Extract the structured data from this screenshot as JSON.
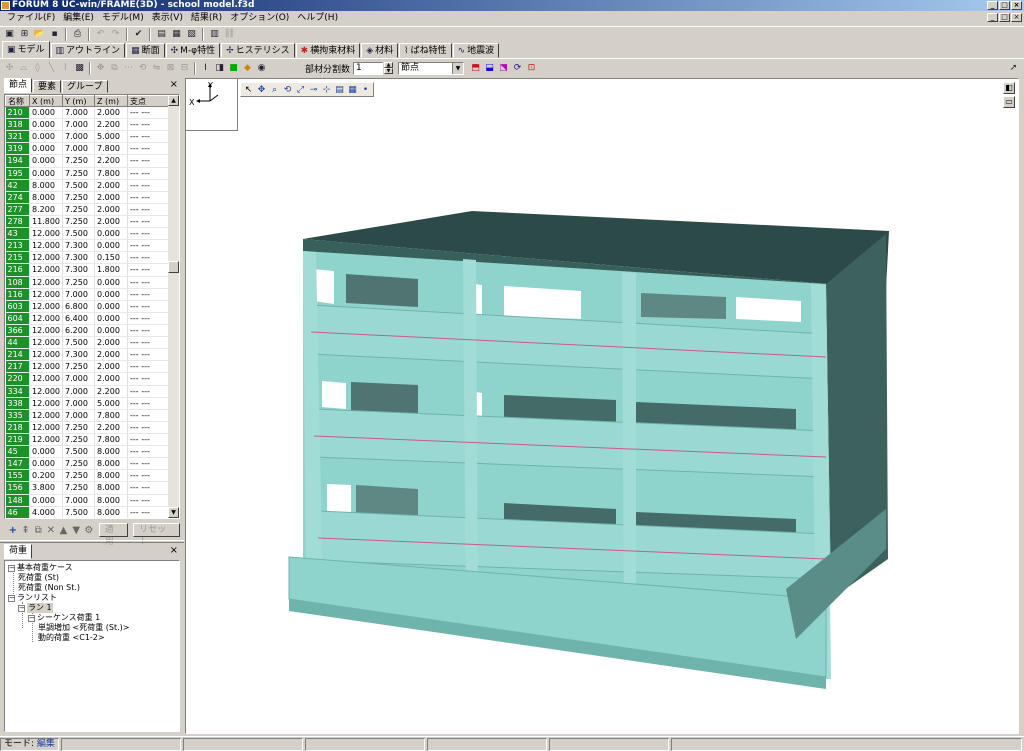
{
  "window": {
    "title": "FORUM 8  UC-win/FRAME(3D) - school model.f3d",
    "buttons": [
      "_",
      "□",
      "×"
    ]
  },
  "menu": [
    "ファイル(F)",
    "編集(E)",
    "モデル(M)",
    "表示(V)",
    "結果(R)",
    "オプション(O)",
    "ヘルプ(H)"
  ],
  "tabs": [
    {
      "label": "モデル",
      "icon": "model-icon",
      "active": true
    },
    {
      "label": "アウトライン",
      "icon": "outline-icon"
    },
    {
      "label": "断面",
      "icon": "section-icon"
    },
    {
      "label": "M-φ特性",
      "icon": "m-phi-icon"
    },
    {
      "label": "ヒステリシス",
      "icon": "hysteresis-icon"
    },
    {
      "label": "横拘束材料",
      "icon": "confinement-icon"
    },
    {
      "label": "材料",
      "icon": "material-icon"
    },
    {
      "label": "ばね特性",
      "icon": "spring-icon"
    },
    {
      "label": "地震波",
      "icon": "wave-icon"
    }
  ],
  "toolbar2": {
    "segment_label": "部材分割数",
    "segment_value": "1",
    "select_value": "節点"
  },
  "left_panel": {
    "tabs": [
      "節点",
      "要素",
      "グループ"
    ],
    "close": "×",
    "columns": [
      "名称",
      "X (m)",
      "Y (m)",
      "Z (m)",
      "支点"
    ],
    "rows": [
      [
        "210",
        "0.000",
        "7.000",
        "2.000",
        "--- ---"
      ],
      [
        "318",
        "0.000",
        "7.000",
        "2.200",
        "--- ---"
      ],
      [
        "321",
        "0.000",
        "7.000",
        "5.000",
        "--- ---"
      ],
      [
        "319",
        "0.000",
        "7.000",
        "7.800",
        "--- ---"
      ],
      [
        "194",
        "0.000",
        "7.250",
        "2.200",
        "--- ---"
      ],
      [
        "195",
        "0.000",
        "7.250",
        "7.800",
        "--- ---"
      ],
      [
        "42",
        "8.000",
        "7.500",
        "2.000",
        "--- ---"
      ],
      [
        "274",
        "8.000",
        "7.250",
        "2.000",
        "--- ---"
      ],
      [
        "277",
        "8.200",
        "7.250",
        "2.000",
        "--- ---"
      ],
      [
        "278",
        "11.800",
        "7.250",
        "2.000",
        "--- ---"
      ],
      [
        "43",
        "12.000",
        "7.500",
        "0.000",
        "--- ---"
      ],
      [
        "213",
        "12.000",
        "7.300",
        "0.000",
        "--- ---"
      ],
      [
        "215",
        "12.000",
        "7.300",
        "0.150",
        "--- ---"
      ],
      [
        "216",
        "12.000",
        "7.300",
        "1.800",
        "--- ---"
      ],
      [
        "108",
        "12.000",
        "7.250",
        "0.000",
        "--- ---"
      ],
      [
        "116",
        "12.000",
        "7.000",
        "0.000",
        "--- ---"
      ],
      [
        "603",
        "12.000",
        "6.800",
        "0.000",
        "--- ---"
      ],
      [
        "604",
        "12.000",
        "6.400",
        "0.000",
        "--- ---"
      ],
      [
        "366",
        "12.000",
        "6.200",
        "0.000",
        "--- ---"
      ],
      [
        "44",
        "12.000",
        "7.500",
        "2.000",
        "--- ---"
      ],
      [
        "214",
        "12.000",
        "7.300",
        "2.000",
        "--- ---"
      ],
      [
        "217",
        "12.000",
        "7.250",
        "2.000",
        "--- ---"
      ],
      [
        "220",
        "12.000",
        "7.000",
        "2.000",
        "--- ---"
      ],
      [
        "334",
        "12.000",
        "7.000",
        "2.200",
        "--- ---"
      ],
      [
        "338",
        "12.000",
        "7.000",
        "5.000",
        "--- ---"
      ],
      [
        "335",
        "12.000",
        "7.000",
        "7.800",
        "--- ---"
      ],
      [
        "218",
        "12.000",
        "7.250",
        "2.200",
        "--- ---"
      ],
      [
        "219",
        "12.000",
        "7.250",
        "7.800",
        "--- ---"
      ],
      [
        "45",
        "0.000",
        "7.500",
        "8.000",
        "--- ---"
      ],
      [
        "147",
        "0.000",
        "7.250",
        "8.000",
        "--- ---"
      ],
      [
        "155",
        "0.200",
        "7.250",
        "8.000",
        "--- ---"
      ],
      [
        "156",
        "3.800",
        "7.250",
        "8.000",
        "--- ---"
      ],
      [
        "148",
        "0.000",
        "7.000",
        "8.000",
        "--- ---"
      ],
      [
        "46",
        "4.000",
        "7.500",
        "8.000",
        "--- ---"
      ]
    ],
    "apply_label": "適用",
    "reset_label": "リセット"
  },
  "load_panel": {
    "tab": "荷重",
    "close": "×",
    "tree": [
      {
        "text": "基本荷重ケース",
        "level": 0,
        "expander": "−"
      },
      {
        "text": "死荷重 (St)",
        "level": 1
      },
      {
        "text": "死荷重 (Non St.)",
        "level": 1
      },
      {
        "text": "ランリスト",
        "level": 0,
        "expander": "−"
      },
      {
        "text": "ラン 1",
        "level": 1,
        "expander": "−",
        "selected": true
      },
      {
        "text": "シーケンス荷重 1",
        "level": 2,
        "expander": "−"
      },
      {
        "text": "単調増加 <死荷重 (St.)>",
        "level": 3
      },
      {
        "text": "動的荷重 <C1-2>",
        "level": 3
      }
    ]
  },
  "viewport": {
    "axis_x": "X",
    "axis_y": "Y"
  },
  "status": {
    "mode_label": "モード:",
    "mode_value": "編集"
  },
  "colors": {
    "model_face": "#8fd3cd",
    "model_dark": "#335450",
    "node_cell": "#1f8f2a",
    "title_start": "#0a246a"
  }
}
